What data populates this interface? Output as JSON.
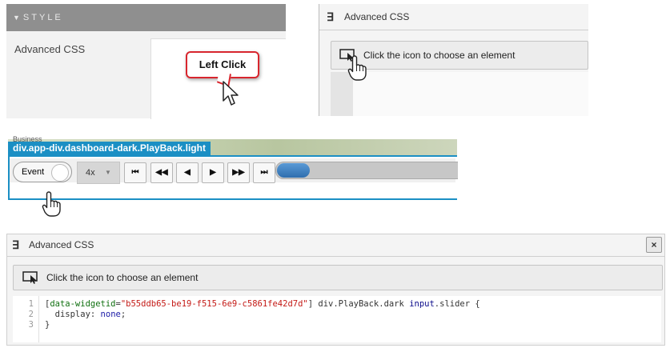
{
  "style_panel": {
    "header": "STYLE",
    "field_label": "Advanced CSS",
    "callout": "Left Click"
  },
  "css_panel_small": {
    "title": "Advanced CSS",
    "picker_label": "Click the icon to choose an element"
  },
  "playback_panel": {
    "tooltip_tag": "div.app-div.dashboard-dark.PlayBack.light",
    "map_text": "Business",
    "toggle_label": "Event",
    "speed_value": "4x",
    "buttons": [
      "skip-to-start",
      "step-back",
      "play-reverse",
      "play",
      "step-forward",
      "skip-to-end"
    ],
    "slider_progress": 0.18
  },
  "css_panel_large": {
    "title": "Advanced CSS",
    "close_label": "×",
    "picker_label": "Click the icon to choose an element",
    "code": {
      "line_numbers": [
        "1",
        "2",
        "3"
      ],
      "line1_open": "[",
      "line1_attr": "data-widgetid",
      "line1_eq": "=",
      "line1_value": "\"b55ddb65-be19-f515-6e9-c5861fe42d7d\"",
      "line1_close": "]",
      "line1_selector": " div.PlayBack.dark ",
      "line1_input": "input",
      "line1_rest": ".slider {",
      "line2_prop": "  display: ",
      "line2_value": "none",
      "line2_end": ";",
      "line3": "}"
    }
  },
  "colors": {
    "accent_blue": "#1b8fc4",
    "callout_red": "#d8262e",
    "style_header_bg": "#8f8f8f"
  }
}
